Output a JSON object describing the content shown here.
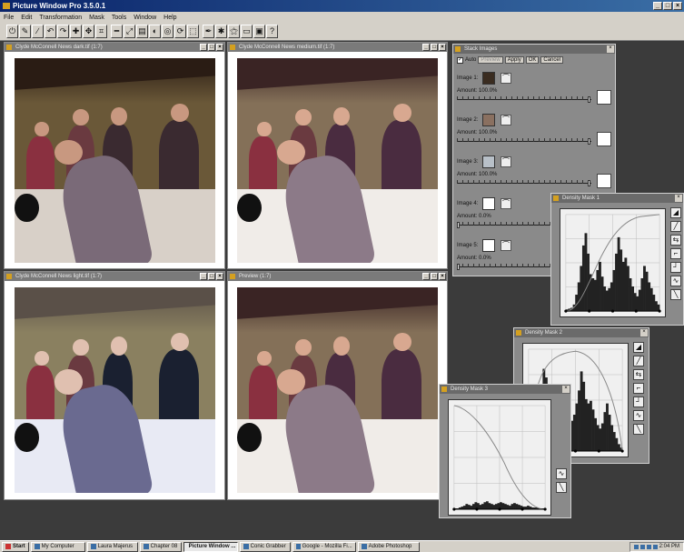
{
  "app": {
    "title": "Picture Window Pro 3.5.0.1"
  },
  "menu": [
    "File",
    "Edit",
    "Transformation",
    "Mask",
    "Tools",
    "Window",
    "Help"
  ],
  "toolbar": {
    "icons": [
      "power-icon",
      "brush-icon",
      "pencil-icon",
      "undo-icon",
      "redo-icon",
      "plus-icon",
      "move-icon",
      "crop-icon",
      "minus-icon",
      "resize-icon",
      "layers-icon",
      "mask-icon",
      "view-icon",
      "rotate-icon",
      "transform-icon",
      "pen-icon",
      "star-icon",
      "wand-icon",
      "eraser-icon",
      "film-icon",
      "help-icon"
    ],
    "glyphs": [
      "⏻",
      "✎",
      "∕",
      "↶",
      "↷",
      "✚",
      "✥",
      "⌗",
      "━",
      "⤢",
      "▤",
      "◐",
      "◎",
      "⟳",
      "⬚",
      "✒",
      "✱",
      "⚝",
      "▭",
      "▣",
      "?"
    ]
  },
  "windows": {
    "dark": {
      "title": "Clyde McConnell News dark.tif (1:7)"
    },
    "medium": {
      "title": "Clyde McConnell News medium.tif (1:7)"
    },
    "light": {
      "title": "Clyde McConnell News light.tif (1:7)"
    },
    "preview": {
      "title": "Preview (1:7)"
    }
  },
  "stack": {
    "title": "Stack Images",
    "auto": "Auto",
    "buttons": [
      "Preview",
      "Apply",
      "OK",
      "Cancel"
    ],
    "images": [
      {
        "label": "Image 1:",
        "amount": "Amount: 100.0%",
        "level": 1.0
      },
      {
        "label": "Image 2:",
        "amount": "Amount: 100.0%",
        "level": 1.0
      },
      {
        "label": "Image 3:",
        "amount": "Amount: 100.0%",
        "level": 1.0
      },
      {
        "label": "Image 4:",
        "amount": "Amount: 0.0%",
        "level": 0.0
      },
      {
        "label": "Image 5:",
        "amount": "Amount: 0.0%",
        "level": 0.0
      }
    ]
  },
  "masks": {
    "m1": {
      "title": "Density Mask 1"
    },
    "m2": {
      "title": "Density Mask 2"
    },
    "m3": {
      "title": "Density Mask 3"
    }
  },
  "taskbar": {
    "start": "Start",
    "tasks": [
      "My Computer",
      "Laura Majerus",
      "Chapter 08",
      "Picture Window ...",
      "Conic Grabber",
      "Google - Mozilla Fi...",
      "Adobe Photoshop"
    ],
    "active_index": 3,
    "clock": "2:04 PM"
  },
  "colors": {
    "title_bar": "#0a246a",
    "workspace": "#3b3b3b",
    "chrome": "#d4d0c8"
  }
}
